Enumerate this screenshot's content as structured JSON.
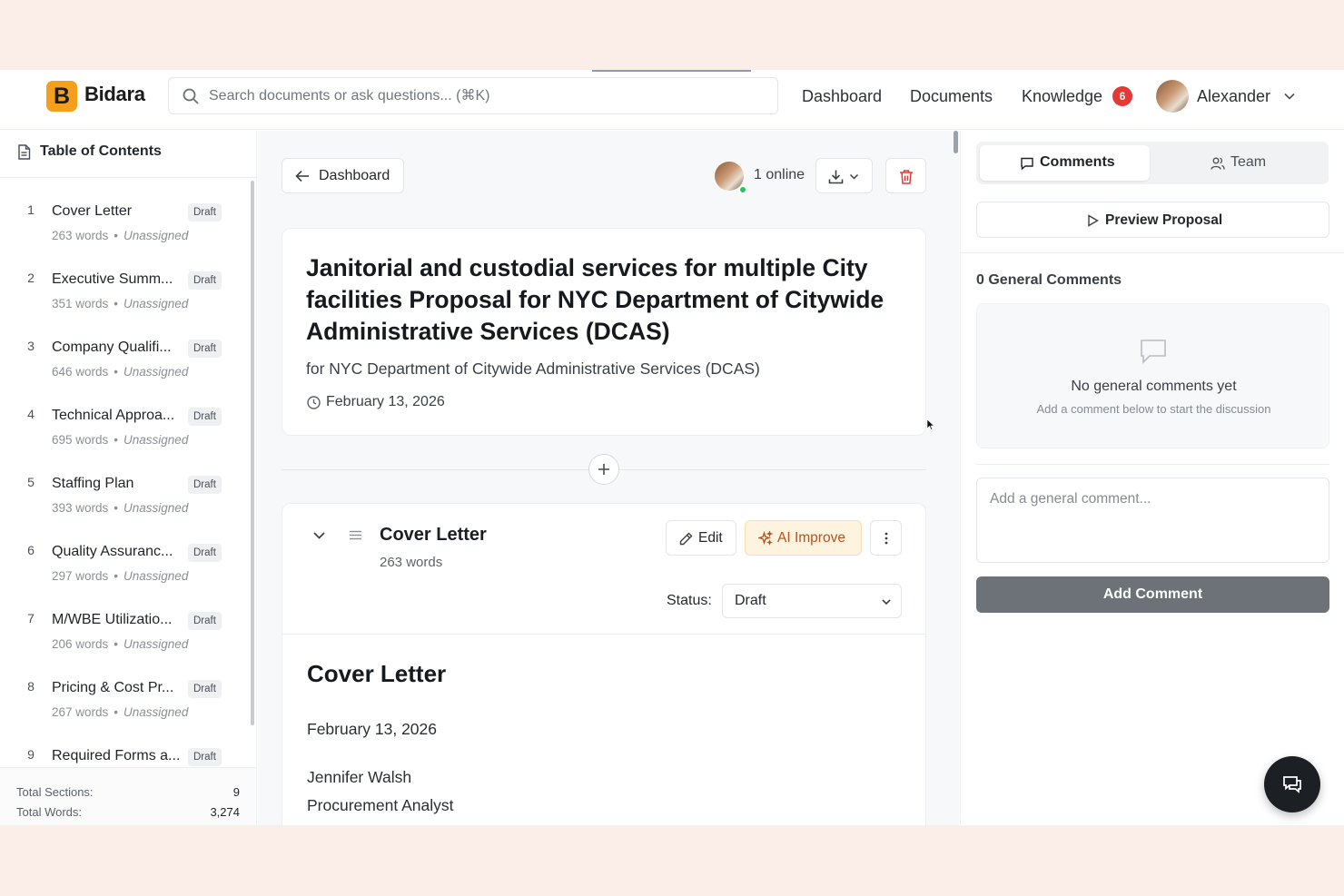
{
  "header": {
    "brand_letter": "B",
    "brand_name": "Bidara",
    "search_placeholder": "Search documents or ask questions... (⌘K)",
    "nav": {
      "dashboard": "Dashboard",
      "documents": "Documents",
      "knowledge": "Knowledge",
      "knowledge_badge": "6"
    },
    "user_name": "Alexander"
  },
  "sidebar": {
    "title": "Table of Contents",
    "items": [
      {
        "num": "1",
        "name": "Cover Letter",
        "status": "Draft",
        "words": "263 words",
        "assignee": "Unassigned"
      },
      {
        "num": "2",
        "name": "Executive Summ...",
        "status": "Draft",
        "words": "351 words",
        "assignee": "Unassigned"
      },
      {
        "num": "3",
        "name": "Company Qualifi...",
        "status": "Draft",
        "words": "646 words",
        "assignee": "Unassigned"
      },
      {
        "num": "4",
        "name": "Technical Approa...",
        "status": "Draft",
        "words": "695 words",
        "assignee": "Unassigned"
      },
      {
        "num": "5",
        "name": "Staffing Plan",
        "status": "Draft",
        "words": "393 words",
        "assignee": "Unassigned"
      },
      {
        "num": "6",
        "name": "Quality Assuranc...",
        "status": "Draft",
        "words": "297 words",
        "assignee": "Unassigned"
      },
      {
        "num": "7",
        "name": "M/WBE Utilizatio...",
        "status": "Draft",
        "words": "206 words",
        "assignee": "Unassigned"
      },
      {
        "num": "8",
        "name": "Pricing & Cost Pr...",
        "status": "Draft",
        "words": "267 words",
        "assignee": "Unassigned"
      },
      {
        "num": "9",
        "name": "Required Forms a...",
        "status": "Draft",
        "words": "",
        "assignee": ""
      }
    ],
    "footer": {
      "total_sections_label": "Total Sections:",
      "total_sections": "9",
      "total_words_label": "Total Words:",
      "total_words": "3,274"
    }
  },
  "toolbar": {
    "back_label": "Dashboard",
    "online_text": "1 online"
  },
  "proposal": {
    "title": "Janitorial and custodial services for multiple City facilities Proposal for NYC Department of Citywide Administrative Services (DCAS)",
    "subtitle": "for NYC Department of Citywide Administrative Services (DCAS)",
    "date": "February 13, 2026"
  },
  "section": {
    "title": "Cover Letter",
    "words": "263 words",
    "edit_label": "Edit",
    "ai_label": "AI Improve",
    "status_label": "Status:",
    "status_value": "Draft",
    "content": {
      "heading": "Cover Letter",
      "date": "February 13, 2026",
      "name": "Jennifer Walsh",
      "role": "Procurement Analyst"
    }
  },
  "right_panel": {
    "tabs": {
      "comments": "Comments",
      "team": "Team"
    },
    "preview_label": "Preview Proposal",
    "comments_count": "0 General Comments",
    "empty_title": "No general comments yet",
    "empty_sub": "Add a comment below to start the discussion",
    "comment_placeholder": "Add a general comment...",
    "add_comment_label": "Add Comment"
  },
  "colors": {
    "brand": "#f4a01c",
    "badge": "#e53935",
    "online": "#22c55e",
    "delete": "#e53935",
    "ai_accent": "#b6531e"
  }
}
